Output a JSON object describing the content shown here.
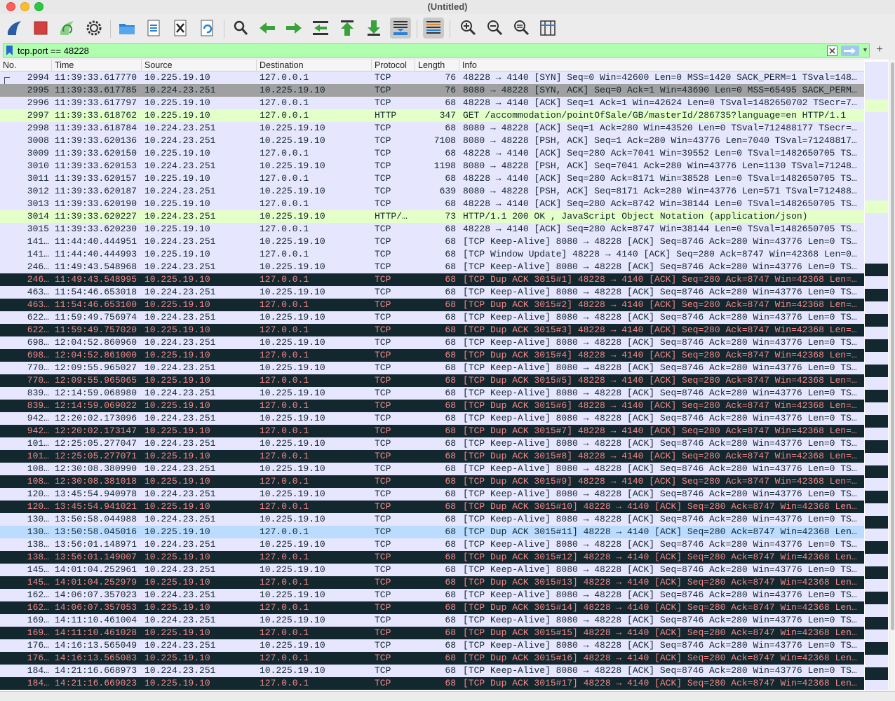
{
  "window": {
    "title": "(Untitled)"
  },
  "toolbar": {
    "buttons": [
      {
        "name": "start-capture-icon",
        "color": "#2a5ca8"
      },
      {
        "name": "stop-capture-icon",
        "color": "#d24040"
      },
      {
        "name": "restart-capture-icon",
        "color": "#4aaa4a"
      },
      {
        "name": "capture-options-icon",
        "color": "#333333"
      },
      {
        "name": "open-file-icon",
        "color": "#2a82d6"
      },
      {
        "name": "save-file-icon",
        "color": "#2a82d6"
      },
      {
        "name": "close-file-icon",
        "color": "#333333"
      },
      {
        "name": "reload-file-icon",
        "color": "#2a82d6"
      },
      {
        "name": "find-packet-icon",
        "color": "#333333"
      },
      {
        "name": "go-back-icon",
        "color": "#3aa23a"
      },
      {
        "name": "go-forward-icon",
        "color": "#3aa23a"
      },
      {
        "name": "go-to-packet-icon",
        "color": "#3aa23a"
      },
      {
        "name": "go-first-icon",
        "color": "#3aa23a"
      },
      {
        "name": "go-last-icon",
        "color": "#3aa23a"
      },
      {
        "name": "auto-scroll-icon",
        "color": "#2a82d6"
      },
      {
        "name": "colorize-icon",
        "color": "#333333"
      },
      {
        "name": "zoom-in-icon",
        "color": "#333333"
      },
      {
        "name": "zoom-out-icon",
        "color": "#333333"
      },
      {
        "name": "normal-size-icon",
        "color": "#333333"
      },
      {
        "name": "resize-columns-icon",
        "color": "#2a82d6"
      }
    ]
  },
  "filter": {
    "value": "tcp.port == 48228",
    "bookmark_icon": "bookmark-icon",
    "clear_icon": "clear-icon",
    "apply_icon": "arrow-right-icon",
    "add_label": "+"
  },
  "columns": [
    "No.",
    "Time",
    "Source",
    "Destination",
    "Protocol",
    "Length",
    "Info"
  ],
  "colors": {
    "tcp": "#e7e6ff",
    "http": "#e4ffc7",
    "bad_bg": "#12272e",
    "bad_fg": "#f78787",
    "selected": "#a0a0a0",
    "current": "#bcdcff"
  },
  "packets": [
    {
      "no": "2994",
      "time": "11:39:33.617770",
      "src": "10.225.19.10",
      "dst": "127.0.0.1",
      "proto": "TCP",
      "len": "76",
      "info": "48228 → 4140 [SYN] Seq=0 Win=42600 Len=0 MSS=1420 SACK_PERM=1 TSval=148…",
      "type": "tcp"
    },
    {
      "no": "2995",
      "time": "11:39:33.617785",
      "src": "10.224.23.251",
      "dst": "10.225.19.10",
      "proto": "TCP",
      "len": "76",
      "info": "8080 → 48228 [SYN, ACK] Seq=0 Ack=1 Win=43690 Len=0 MSS=65495 SACK_PERM…",
      "type": "sel"
    },
    {
      "no": "2996",
      "time": "11:39:33.617797",
      "src": "10.225.19.10",
      "dst": "127.0.0.1",
      "proto": "TCP",
      "len": "68",
      "info": "48228 → 4140 [ACK] Seq=1 Ack=1 Win=42624 Len=0 TSval=1482650702 TSecr=7…",
      "type": "tcp"
    },
    {
      "no": "2997",
      "time": "11:39:33.618762",
      "src": "10.225.19.10",
      "dst": "127.0.0.1",
      "proto": "HTTP",
      "len": "347",
      "info": "GET /accommodation/pointOfSale/GB/masterId/286735?language=en HTTP/1.1",
      "type": "http"
    },
    {
      "no": "2998",
      "time": "11:39:33.618784",
      "src": "10.224.23.251",
      "dst": "10.225.19.10",
      "proto": "TCP",
      "len": "68",
      "info": "8080 → 48228 [ACK] Seq=1 Ack=280 Win=43520 Len=0 TSval=712488177 TSecr=…",
      "type": "tcp"
    },
    {
      "no": "3008",
      "time": "11:39:33.620136",
      "src": "10.224.23.251",
      "dst": "10.225.19.10",
      "proto": "TCP",
      "len": "7108",
      "info": "8080 → 48228 [PSH, ACK] Seq=1 Ack=280 Win=43776 Len=7040 TSval=71248817…",
      "type": "tcp"
    },
    {
      "no": "3009",
      "time": "11:39:33.620150",
      "src": "10.225.19.10",
      "dst": "127.0.0.1",
      "proto": "TCP",
      "len": "68",
      "info": "48228 → 4140 [ACK] Seq=280 Ack=7041 Win=39552 Len=0 TSval=1482650705 TS…",
      "type": "tcp"
    },
    {
      "no": "3010",
      "time": "11:39:33.620153",
      "src": "10.224.23.251",
      "dst": "10.225.19.10",
      "proto": "TCP",
      "len": "1198",
      "info": "8080 → 48228 [PSH, ACK] Seq=7041 Ack=280 Win=43776 Len=1130 TSval=71248…",
      "type": "tcp"
    },
    {
      "no": "3011",
      "time": "11:39:33.620157",
      "src": "10.225.19.10",
      "dst": "127.0.0.1",
      "proto": "TCP",
      "len": "68",
      "info": "48228 → 4140 [ACK] Seq=280 Ack=8171 Win=38528 Len=0 TSval=1482650705 TS…",
      "type": "tcp"
    },
    {
      "no": "3012",
      "time": "11:39:33.620187",
      "src": "10.224.23.251",
      "dst": "10.225.19.10",
      "proto": "TCP",
      "len": "639",
      "info": "8080 → 48228 [PSH, ACK] Seq=8171 Ack=280 Win=43776 Len=571 TSval=712488…",
      "type": "tcp"
    },
    {
      "no": "3013",
      "time": "11:39:33.620190",
      "src": "10.225.19.10",
      "dst": "127.0.0.1",
      "proto": "TCP",
      "len": "68",
      "info": "48228 → 4140 [ACK] Seq=280 Ack=8742 Win=38144 Len=0 TSval=1482650705 TS…",
      "type": "tcp"
    },
    {
      "no": "3014",
      "time": "11:39:33.620227",
      "src": "10.224.23.251",
      "dst": "10.225.19.10",
      "proto": "HTTP/…",
      "len": "73",
      "info": "HTTP/1.1 200 OK , JavaScript Object Notation (application/json)",
      "type": "http"
    },
    {
      "no": "3015",
      "time": "11:39:33.620230",
      "src": "10.225.19.10",
      "dst": "127.0.0.1",
      "proto": "TCP",
      "len": "68",
      "info": "48228 → 4140 [ACK] Seq=280 Ack=8747 Win=38144 Len=0 TSval=1482650705 TS…",
      "type": "tcp"
    },
    {
      "no": "141…",
      "time": "11:44:40.444951",
      "src": "10.224.23.251",
      "dst": "10.225.19.10",
      "proto": "TCP",
      "len": "68",
      "info": "[TCP Keep-Alive] 8080 → 48228 [ACK] Seq=8746 Ack=280 Win=43776 Len=0 TS…",
      "type": "tcp"
    },
    {
      "no": "141…",
      "time": "11:44:40.444993",
      "src": "10.225.19.10",
      "dst": "127.0.0.1",
      "proto": "TCP",
      "len": "68",
      "info": "[TCP Window Update] 48228 → 4140 [ACK] Seq=280 Ack=8747 Win=42368 Len=0…",
      "type": "tcp"
    },
    {
      "no": "246…",
      "time": "11:49:43.548968",
      "src": "10.224.23.251",
      "dst": "10.225.19.10",
      "proto": "TCP",
      "len": "68",
      "info": "[TCP Keep-Alive] 8080 → 48228 [ACK] Seq=8746 Ack=280 Win=43776 Len=0 TS…",
      "type": "tcp"
    },
    {
      "no": "246…",
      "time": "11:49:43.548995",
      "src": "10.225.19.10",
      "dst": "127.0.0.1",
      "proto": "TCP",
      "len": "68",
      "info": "[TCP Dup ACK 3015#1] 48228 → 4140 [ACK] Seq=280 Ack=8747 Win=42368 Len=…",
      "type": "bad"
    },
    {
      "no": "463…",
      "time": "11:54:46.653018",
      "src": "10.224.23.251",
      "dst": "10.225.19.10",
      "proto": "TCP",
      "len": "68",
      "info": "[TCP Keep-Alive] 8080 → 48228 [ACK] Seq=8746 Ack=280 Win=43776 Len=0 TS…",
      "type": "tcp"
    },
    {
      "no": "463…",
      "time": "11:54:46.653100",
      "src": "10.225.19.10",
      "dst": "127.0.0.1",
      "proto": "TCP",
      "len": "68",
      "info": "[TCP Dup ACK 3015#2] 48228 → 4140 [ACK] Seq=280 Ack=8747 Win=42368 Len=…",
      "type": "bad"
    },
    {
      "no": "622…",
      "time": "11:59:49.756974",
      "src": "10.224.23.251",
      "dst": "10.225.19.10",
      "proto": "TCP",
      "len": "68",
      "info": "[TCP Keep-Alive] 8080 → 48228 [ACK] Seq=8746 Ack=280 Win=43776 Len=0 TS…",
      "type": "tcp"
    },
    {
      "no": "622…",
      "time": "11:59:49.757020",
      "src": "10.225.19.10",
      "dst": "127.0.0.1",
      "proto": "TCP",
      "len": "68",
      "info": "[TCP Dup ACK 3015#3] 48228 → 4140 [ACK] Seq=280 Ack=8747 Win=42368 Len=…",
      "type": "bad"
    },
    {
      "no": "698…",
      "time": "12:04:52.860960",
      "src": "10.224.23.251",
      "dst": "10.225.19.10",
      "proto": "TCP",
      "len": "68",
      "info": "[TCP Keep-Alive] 8080 → 48228 [ACK] Seq=8746 Ack=280 Win=43776 Len=0 TS…",
      "type": "tcp"
    },
    {
      "no": "698…",
      "time": "12:04:52.861000",
      "src": "10.225.19.10",
      "dst": "127.0.0.1",
      "proto": "TCP",
      "len": "68",
      "info": "[TCP Dup ACK 3015#4] 48228 → 4140 [ACK] Seq=280 Ack=8747 Win=42368 Len=…",
      "type": "bad"
    },
    {
      "no": "770…",
      "time": "12:09:55.965027",
      "src": "10.224.23.251",
      "dst": "10.225.19.10",
      "proto": "TCP",
      "len": "68",
      "info": "[TCP Keep-Alive] 8080 → 48228 [ACK] Seq=8746 Ack=280 Win=43776 Len=0 TS…",
      "type": "tcp"
    },
    {
      "no": "770…",
      "time": "12:09:55.965065",
      "src": "10.225.19.10",
      "dst": "127.0.0.1",
      "proto": "TCP",
      "len": "68",
      "info": "[TCP Dup ACK 3015#5] 48228 → 4140 [ACK] Seq=280 Ack=8747 Win=42368 Len=…",
      "type": "bad"
    },
    {
      "no": "839…",
      "time": "12:14:59.068980",
      "src": "10.224.23.251",
      "dst": "10.225.19.10",
      "proto": "TCP",
      "len": "68",
      "info": "[TCP Keep-Alive] 8080 → 48228 [ACK] Seq=8746 Ack=280 Win=43776 Len=0 TS…",
      "type": "tcp"
    },
    {
      "no": "839…",
      "time": "12:14:59.069022",
      "src": "10.225.19.10",
      "dst": "127.0.0.1",
      "proto": "TCP",
      "len": "68",
      "info": "[TCP Dup ACK 3015#6] 48228 → 4140 [ACK] Seq=280 Ack=8747 Win=42368 Len=…",
      "type": "bad"
    },
    {
      "no": "942…",
      "time": "12:20:02.173096",
      "src": "10.224.23.251",
      "dst": "10.225.19.10",
      "proto": "TCP",
      "len": "68",
      "info": "[TCP Keep-Alive] 8080 → 48228 [ACK] Seq=8746 Ack=280 Win=43776 Len=0 TS…",
      "type": "tcp"
    },
    {
      "no": "942…",
      "time": "12:20:02.173147",
      "src": "10.225.19.10",
      "dst": "127.0.0.1",
      "proto": "TCP",
      "len": "68",
      "info": "[TCP Dup ACK 3015#7] 48228 → 4140 [ACK] Seq=280 Ack=8747 Win=42368 Len=…",
      "type": "bad"
    },
    {
      "no": "101…",
      "time": "12:25:05.277047",
      "src": "10.224.23.251",
      "dst": "10.225.19.10",
      "proto": "TCP",
      "len": "68",
      "info": "[TCP Keep-Alive] 8080 → 48228 [ACK] Seq=8746 Ack=280 Win=43776 Len=0 TS…",
      "type": "tcp"
    },
    {
      "no": "101…",
      "time": "12:25:05.277071",
      "src": "10.225.19.10",
      "dst": "127.0.0.1",
      "proto": "TCP",
      "len": "68",
      "info": "[TCP Dup ACK 3015#8] 48228 → 4140 [ACK] Seq=280 Ack=8747 Win=42368 Len=…",
      "type": "bad"
    },
    {
      "no": "108…",
      "time": "12:30:08.380990",
      "src": "10.224.23.251",
      "dst": "10.225.19.10",
      "proto": "TCP",
      "len": "68",
      "info": "[TCP Keep-Alive] 8080 → 48228 [ACK] Seq=8746 Ack=280 Win=43776 Len=0 TS…",
      "type": "tcp"
    },
    {
      "no": "108…",
      "time": "12:30:08.381018",
      "src": "10.225.19.10",
      "dst": "127.0.0.1",
      "proto": "TCP",
      "len": "68",
      "info": "[TCP Dup ACK 3015#9] 48228 → 4140 [ACK] Seq=280 Ack=8747 Win=42368 Len=…",
      "type": "bad"
    },
    {
      "no": "120…",
      "time": "13:45:54.940978",
      "src": "10.224.23.251",
      "dst": "10.225.19.10",
      "proto": "TCP",
      "len": "68",
      "info": "[TCP Keep-Alive] 8080 → 48228 [ACK] Seq=8746 Ack=280 Win=43776 Len=0 TS…",
      "type": "tcp"
    },
    {
      "no": "120…",
      "time": "13:45:54.941021",
      "src": "10.225.19.10",
      "dst": "127.0.0.1",
      "proto": "TCP",
      "len": "68",
      "info": "[TCP Dup ACK 3015#10] 48228 → 4140 [ACK] Seq=280 Ack=8747 Win=42368 Len…",
      "type": "bad"
    },
    {
      "no": "130…",
      "time": "13:50:58.044988",
      "src": "10.224.23.251",
      "dst": "10.225.19.10",
      "proto": "TCP",
      "len": "68",
      "info": "[TCP Keep-Alive] 8080 → 48228 [ACK] Seq=8746 Ack=280 Win=43776 Len=0 TS…",
      "type": "tcp"
    },
    {
      "no": "130…",
      "time": "13:50:58.045016",
      "src": "10.225.19.10",
      "dst": "127.0.0.1",
      "proto": "TCP",
      "len": "68",
      "info": "[TCP Dup ACK 3015#11] 48228 → 4140 [ACK] Seq=280 Ack=8747 Win=42368 Len…",
      "type": "cur"
    },
    {
      "no": "138…",
      "time": "13:56:01.148971",
      "src": "10.224.23.251",
      "dst": "10.225.19.10",
      "proto": "TCP",
      "len": "68",
      "info": "[TCP Keep-Alive] 8080 → 48228 [ACK] Seq=8746 Ack=280 Win=43776 Len=0 TS…",
      "type": "tcp"
    },
    {
      "no": "138…",
      "time": "13:56:01.149007",
      "src": "10.225.19.10",
      "dst": "127.0.0.1",
      "proto": "TCP",
      "len": "68",
      "info": "[TCP Dup ACK 3015#12] 48228 → 4140 [ACK] Seq=280 Ack=8747 Win=42368 Len…",
      "type": "bad"
    },
    {
      "no": "145…",
      "time": "14:01:04.252961",
      "src": "10.224.23.251",
      "dst": "10.225.19.10",
      "proto": "TCP",
      "len": "68",
      "info": "[TCP Keep-Alive] 8080 → 48228 [ACK] Seq=8746 Ack=280 Win=43776 Len=0 TS…",
      "type": "tcp"
    },
    {
      "no": "145…",
      "time": "14:01:04.252979",
      "src": "10.225.19.10",
      "dst": "127.0.0.1",
      "proto": "TCP",
      "len": "68",
      "info": "[TCP Dup ACK 3015#13] 48228 → 4140 [ACK] Seq=280 Ack=8747 Win=42368 Len…",
      "type": "bad"
    },
    {
      "no": "162…",
      "time": "14:06:07.357023",
      "src": "10.224.23.251",
      "dst": "10.225.19.10",
      "proto": "TCP",
      "len": "68",
      "info": "[TCP Keep-Alive] 8080 → 48228 [ACK] Seq=8746 Ack=280 Win=43776 Len=0 TS…",
      "type": "tcp"
    },
    {
      "no": "162…",
      "time": "14:06:07.357053",
      "src": "10.225.19.10",
      "dst": "127.0.0.1",
      "proto": "TCP",
      "len": "68",
      "info": "[TCP Dup ACK 3015#14] 48228 → 4140 [ACK] Seq=280 Ack=8747 Win=42368 Len…",
      "type": "bad"
    },
    {
      "no": "169…",
      "time": "14:11:10.461004",
      "src": "10.224.23.251",
      "dst": "10.225.19.10",
      "proto": "TCP",
      "len": "68",
      "info": "[TCP Keep-Alive] 8080 → 48228 [ACK] Seq=8746 Ack=280 Win=43776 Len=0 TS…",
      "type": "tcp"
    },
    {
      "no": "169…",
      "time": "14:11:10.461028",
      "src": "10.225.19.10",
      "dst": "127.0.0.1",
      "proto": "TCP",
      "len": "68",
      "info": "[TCP Dup ACK 3015#15] 48228 → 4140 [ACK] Seq=280 Ack=8747 Win=42368 Len…",
      "type": "bad"
    },
    {
      "no": "176…",
      "time": "14:16:13.565049",
      "src": "10.224.23.251",
      "dst": "10.225.19.10",
      "proto": "TCP",
      "len": "68",
      "info": "[TCP Keep-Alive] 8080 → 48228 [ACK] Seq=8746 Ack=280 Win=43776 Len=0 TS…",
      "type": "tcp"
    },
    {
      "no": "176…",
      "time": "14:16:13.565083",
      "src": "10.225.19.10",
      "dst": "127.0.0.1",
      "proto": "TCP",
      "len": "68",
      "info": "[TCP Dup ACK 3015#16] 48228 → 4140 [ACK] Seq=280 Ack=8747 Win=42368 Len…",
      "type": "bad"
    },
    {
      "no": "184…",
      "time": "14:21:16.668973",
      "src": "10.224.23.251",
      "dst": "10.225.19.10",
      "proto": "TCP",
      "len": "68",
      "info": "[TCP Keep-Alive] 8080 → 48228 [ACK] Seq=8746 Ack=280 Win=43776 Len=0 TS…",
      "type": "tcp"
    },
    {
      "no": "184…",
      "time": "14:21:16.669023",
      "src": "10.225.19.10",
      "dst": "127.0.0.1",
      "proto": "TCP",
      "len": "68",
      "info": "[TCP Dup ACK 3015#17] 48228 → 4140 [ACK] Seq=280 Ack=8747 Win=42368 Len…",
      "type": "bad"
    }
  ]
}
